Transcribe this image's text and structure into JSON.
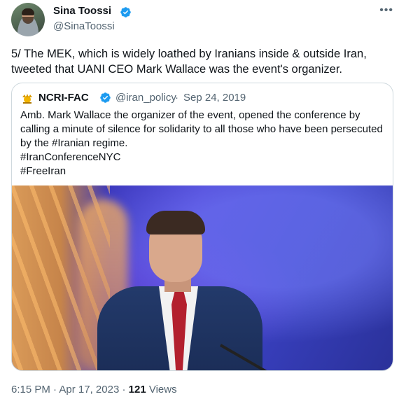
{
  "author": {
    "name": "Sina Toossi",
    "handle": "@SinaToossi",
    "verified_color": "#1d9bf0"
  },
  "more_icon": "more-horizontal-icon",
  "tweet": {
    "text": "5/ The MEK, which is widely loathed by Iranians inside & outside Iran, tweeted that UANI CEO Mark Wallace was the event's organizer."
  },
  "quoted": {
    "name": "NCRI-FAC",
    "handle": "@iran_policy",
    "separator": "·",
    "date": "Sep 24, 2019",
    "text": "Amb. Mark Wallace the organizer of the event, opened the conference by calling a minute of silence for solidarity to all those who have been persecuted by the #Iranian regime.\n #IranConferenceNYC\n#FreeIran"
  },
  "footer": {
    "time": "6:15 PM",
    "separator": "·",
    "date": "Apr 17, 2023",
    "dot": "·",
    "views_count": "121",
    "views_label": "Views"
  }
}
